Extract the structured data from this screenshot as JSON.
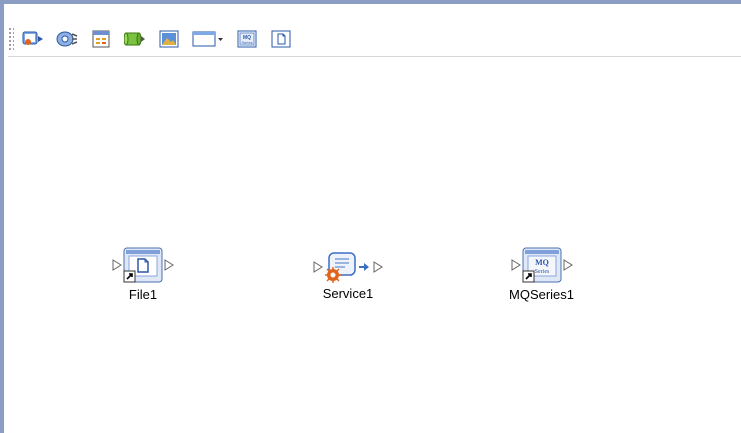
{
  "toolbar": {
    "items": [
      {
        "name": "external-application-icon"
      },
      {
        "name": "service-icon"
      },
      {
        "name": "schedule-icon"
      },
      {
        "name": "database-icon"
      },
      {
        "name": "image-icon"
      },
      {
        "name": "window-dropdown-icon"
      },
      {
        "name": "mqseries-icon"
      },
      {
        "name": "file-icon"
      }
    ]
  },
  "canvas": {
    "nodes": [
      {
        "id": "file",
        "label": "File1"
      },
      {
        "id": "service",
        "label": "Service1"
      },
      {
        "id": "mqseries",
        "label": "MQSeries1"
      }
    ]
  },
  "colors": {
    "frame_border": "#8c9dc4",
    "accent_blue": "#3b6fc2",
    "accent_orange": "#e0641a"
  }
}
